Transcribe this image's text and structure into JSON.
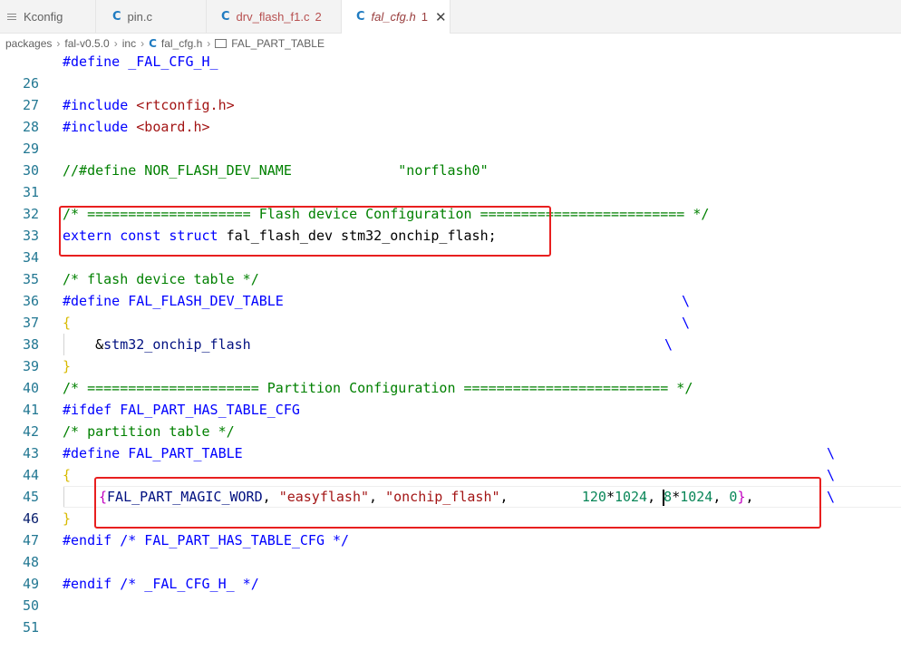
{
  "tabs": [
    {
      "label": "Kconfig",
      "icon": "kconfig-icon"
    },
    {
      "label": "pin.c",
      "icon": "c-file-icon"
    },
    {
      "label": "drv_flash_f1.c",
      "badge": "2",
      "icon": "c-file-icon"
    },
    {
      "label": "fal_cfg.h",
      "badge": "1",
      "icon": "c-file-icon",
      "active": true
    }
  ],
  "close_glyph": "✕",
  "c_glyph": "C",
  "breadcrumb": [
    "packages",
    "fal-v0.5.0",
    "inc",
    "fal_cfg.h",
    "FAL_PART_TABLE"
  ],
  "breadcrumb_sep": "›",
  "lines": {
    "n26": "26",
    "n27": "27",
    "n28": "28",
    "n29": "29",
    "n30": "30",
    "n31": "31",
    "n32": "32",
    "n33": "33",
    "n34": "34",
    "n35": "35",
    "n36": "36",
    "n37": "37",
    "n38": "38",
    "n39": "39",
    "n40": "40",
    "n41": "41",
    "n42": "42",
    "n43": "43",
    "n44": "44",
    "n45": "45",
    "n46": "46",
    "n47": "47",
    "n48": "48",
    "n49": "49",
    "n50": "50",
    "n51": "51"
  },
  "code": {
    "l26": "#define _FAL_CFG_H_",
    "l28_a": "#include ",
    "l28_b": "<rtconfig.h>",
    "l29_a": "#include ",
    "l29_b": "<board.h>",
    "l31_a": "//#define NOR_FLASH_DEV_NAME             ",
    "l31_b": "\"norflash0\"",
    "l33": "/* ==================== Flash device Configuration ========================= */",
    "l34_a": "extern const struct ",
    "l34_b": "fal_flash_dev stm32_onchip_flash;",
    "l36": "/* flash device table */",
    "l37": "#define FAL_FLASH_DEV_TABLE",
    "l38": "{",
    "l39_a": "    &",
    "l39_b": "stm32_onchip_flash",
    "l40": "}",
    "l41": "/* ===================== Partition Configuration ========================= */",
    "l42": "#ifdef FAL_PART_HAS_TABLE_CFG",
    "l43": "/* partition table */",
    "l44": "#define FAL_PART_TABLE",
    "l45": "{",
    "l46_open": "{",
    "l46_word": "FAL_PART_MAGIC_WORD",
    "l46_c1": ", ",
    "l46_s1": "\"easyflash\"",
    "l46_c2": ", ",
    "l46_s2": "\"onchip_flash\"",
    "l46_c3": ",         ",
    "l46_n1": "120",
    "l46_star1": "*",
    "l46_n2": "1024",
    "l46_c4": ", ",
    "l46_n3a": "",
    "l46_n3b": "8",
    "l46_star2": "*",
    "l46_n4": "1024",
    "l46_c5": ", ",
    "l46_n5": "0",
    "l46_close": "}",
    "l46_end": ",",
    "l47": "}",
    "l48": "#endif /* FAL_PART_HAS_TABLE_CFG */",
    "l50": "#endif /* _FAL_CFG_H_ */",
    "backslash": "\\"
  },
  "colors": {
    "highlight_box": "#e81f1f",
    "keyword": "#0000ff",
    "comment": "#008000",
    "string": "#a31515",
    "number": "#098658",
    "line_number": "#237893"
  }
}
